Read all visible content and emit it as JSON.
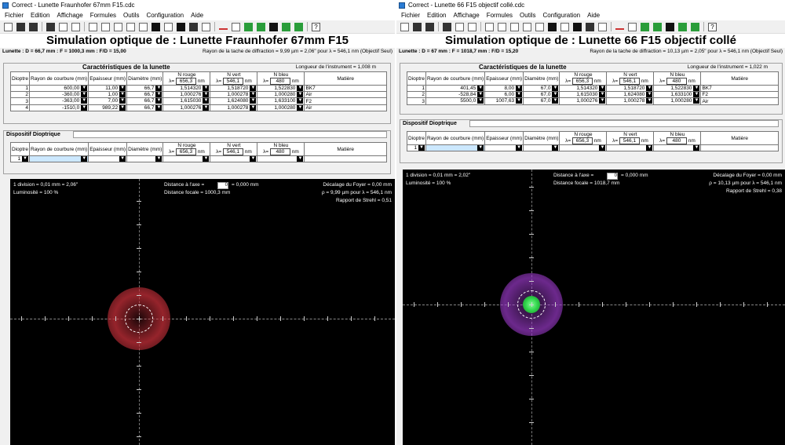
{
  "left": {
    "title": "Correct - Lunette Fraunhofer 67mm F15.cdc",
    "sim_title": "Simulation optique de : Lunette Fraunhofer 67mm F15",
    "lunette_info": "Lunette : D = 66,7 mm : F = 1000,3 mm : F/D = 15,00",
    "diffraction": "Rayon de la tache de diffraction = 9,99 µm = 2,06\" pour λ = 546,1 nm (Objectif Seul)",
    "longueur": "Longueur de l'instrument = 1,008 m",
    "wl": {
      "rouge": "656,3",
      "vert": "546,1",
      "bleu": "480"
    },
    "rows": [
      {
        "n": "1",
        "r": "600,00",
        "e": "11,00",
        "d": "66,7",
        "nr": "1,514320",
        "nv": "1,518720",
        "nb": "1,522830",
        "m": "BK7"
      },
      {
        "n": "2",
        "r": "-360,00",
        "e": "1,00",
        "d": "66,7",
        "nr": "1,000276",
        "nv": "1,000278",
        "nb": "1,000280",
        "m": "Air"
      },
      {
        "n": "3",
        "r": "-363,00",
        "e": "7,00",
        "d": "66,7",
        "nr": "1,615030",
        "nv": "1,624080",
        "nb": "1,633100",
        "m": "F2"
      },
      {
        "n": "4",
        "r": "-1510,0",
        "e": "989,22",
        "d": "66,7",
        "nr": "1,000276",
        "nv": "1,000278",
        "nb": "1,000280",
        "m": "Air"
      }
    ],
    "sim": {
      "division": "1 division = 0,01 mm = 2,06\"",
      "luminosite": "Luminosité = 100 %",
      "dist_axe_label": "Distance à l'axe =",
      "dist_axe_val": "0",
      "dist_axe_mm": "= 0,000 mm",
      "dist_focale": "Distance focale = 1000,3 mm",
      "decalage": "Décalage du Foyer = 0,00 mm",
      "rho": "ρ = 9,99 µm pour λ = 546,1 nm",
      "strehl": "Rapport de Strehl = 0,51"
    }
  },
  "right": {
    "title": "Correct - Lunette 66 F15 objectif collé.cdc",
    "sim_title": "Simulation optique de : Lunette 66 F15 objectif collé",
    "lunette_info": "Lunette : D = 67 mm : F = 1018,7 mm : F/D = 15,20",
    "diffraction": "Rayon de la tache de diffraction = 10,13 µm = 2,05\" pour λ = 546,1 nm (Objectif Seul)",
    "longueur": "Longueur de l'instrument = 1,022 m",
    "wl": {
      "rouge": "656,3",
      "vert": "546,1",
      "bleu": "480"
    },
    "rows": [
      {
        "n": "1",
        "r": "401,45",
        "e": "8,00",
        "d": "67,0",
        "nr": "1,514320",
        "nv": "1,518720",
        "nb": "1,522830",
        "m": "BK7"
      },
      {
        "n": "2",
        "r": "-528,84",
        "e": "6,00",
        "d": "67,0",
        "nr": "1,615030",
        "nv": "1,624080",
        "nb": "1,633100",
        "m": "F2"
      },
      {
        "n": "3",
        "r": "5500,0",
        "e": "1007,63",
        "d": "67,0",
        "nr": "1,000276",
        "nv": "1,000278",
        "nb": "1,000280",
        "m": "Air"
      }
    ],
    "sim": {
      "division": "1 division = 0,01 mm = 2,02\"",
      "luminosite": "Luminosité = 100 %",
      "dist_axe_label": "Distance à l'axe =",
      "dist_axe_val": "0",
      "dist_axe_mm": "= 0,000 mm",
      "dist_focale": "Distance focale = 1018,7 mm",
      "decalage": "Décalage du Foyer = 0,00 mm",
      "rho": "ρ = 10,13 µm pour λ = 546,1 nm",
      "strehl": "Rapport de Strehl = 0,38"
    }
  },
  "menu": [
    "Fichier",
    "Edition",
    "Affichage",
    "Formules",
    "Outils",
    "Configuration",
    "Aide"
  ],
  "labels": {
    "caracteristiques": "Caractéristiques de la lunette",
    "dispositif": "Dispositif Dioptrique",
    "dioptre": "Dioptre",
    "rayon": "Rayon de courbure (mm)",
    "epaisseur": "Epaisseur (mm)",
    "diametre": "Diamètre (mm)",
    "nrouge": "N rouge",
    "nvert": "N vert",
    "nbleu": "N bleu",
    "matiere": "Matière",
    "nm": "nm",
    "lambda": "λ=",
    "disp_row": "1"
  },
  "colors": {
    "left_spot": "#c8303a",
    "right_spot": "#9a3ac8",
    "right_core": "#2fd24a"
  }
}
